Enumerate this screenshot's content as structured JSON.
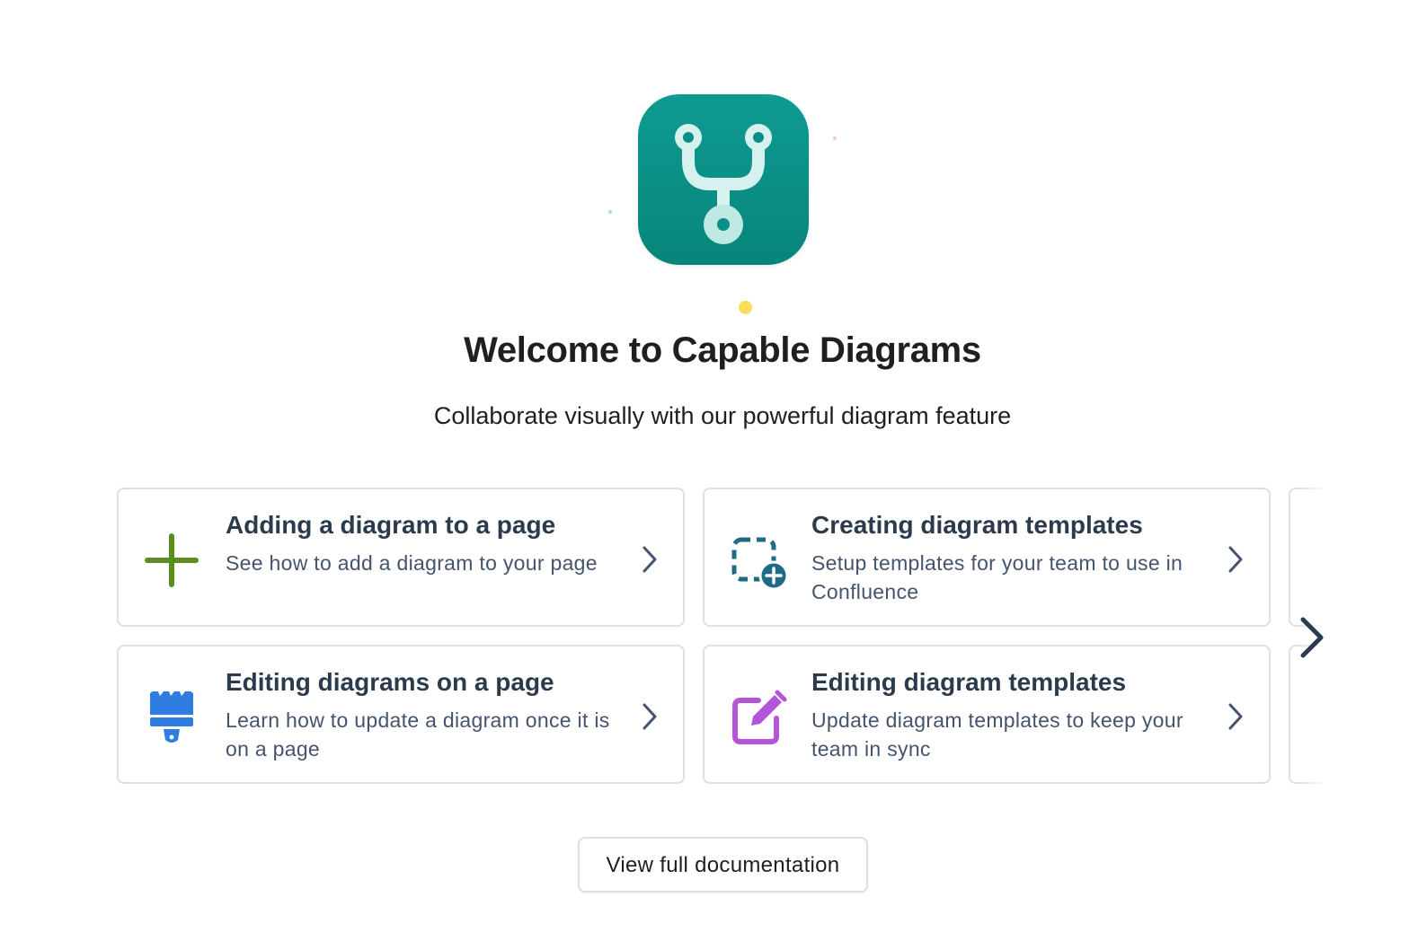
{
  "header": {
    "logo_icon": "branch-diagram-icon",
    "title": "Welcome to Capable Diagrams",
    "subtitle": "Collaborate visually with our powerful diagram feature"
  },
  "cards": [
    {
      "title": "Adding a diagram to a page",
      "description": "See how to add a diagram to your page",
      "icon": "plus-icon",
      "icon_color": "#5b8c1f"
    },
    {
      "title": "Creating diagram templates",
      "description": "Setup templates for your team to use in Confluence",
      "icon": "add-template-icon",
      "icon_color": "#1e6b85"
    },
    {
      "title": "Editing diagrams on a page",
      "description": "Learn how to update a diagram once it is on a page",
      "icon": "paintbrush-icon",
      "icon_color": "#2f7de1"
    },
    {
      "title": "Editing diagram templates",
      "description": "Update diagram templates to keep your team in sync",
      "icon": "edit-icon",
      "icon_color": "#b455d8"
    }
  ],
  "carousel": {
    "next_icon": "chevron-right-icon"
  },
  "footer": {
    "docs_button_label": "View full documentation"
  },
  "colors": {
    "logo_teal": "#0a8f86",
    "card_border": "#dcdfe4",
    "title_text": "#1f1f1f",
    "desc_text": "#44546f"
  }
}
